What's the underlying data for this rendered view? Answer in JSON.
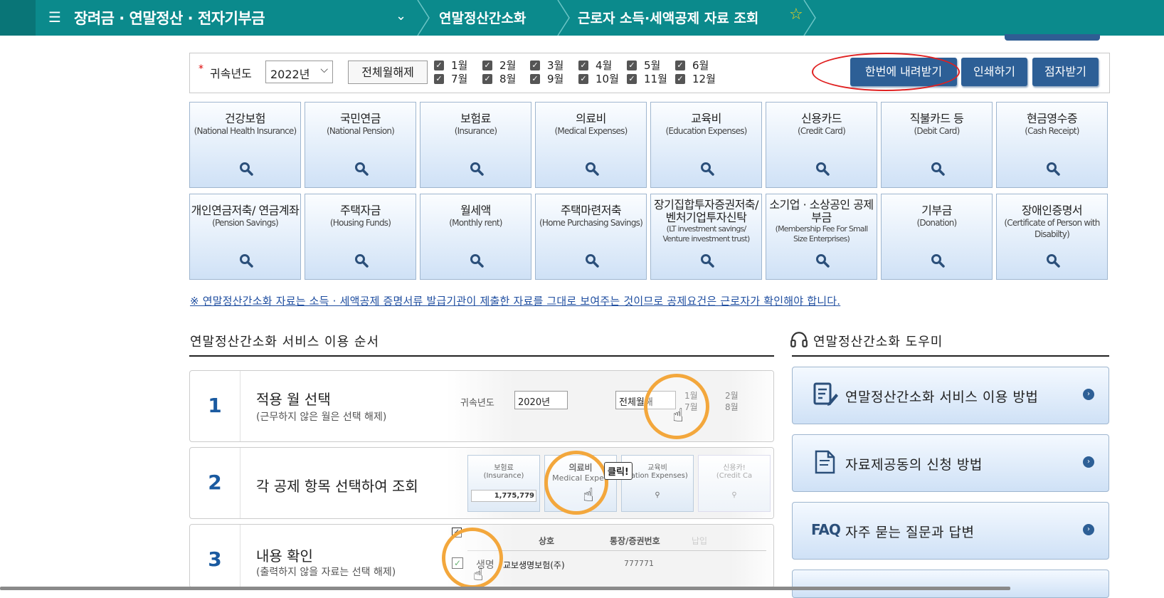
{
  "header": {
    "menu_icon": "hamburger-icon",
    "title": "장려금 · 연말정산 · 전자기부금",
    "crumb1": "연말정산간소화",
    "crumb2": "근로자 소득·세액공제 자료 조회",
    "star_icon": "star-icon",
    "bar_color": "#0b8a8c"
  },
  "filter": {
    "required_mark": "*",
    "year_label": "귀속년도",
    "year_value": "2022년",
    "deselect_all": "전체월해제",
    "months": [
      "1월",
      "2월",
      "3월",
      "4월",
      "5월",
      "6월",
      "7월",
      "8월",
      "9월",
      "10월",
      "11월",
      "12월"
    ],
    "download_all": "한번에 내려받기",
    "print": "인쇄하기",
    "braille": "점자받기"
  },
  "categories": [
    {
      "ko": "건강보험",
      "en": "(National Health Insurance)"
    },
    {
      "ko": "국민연금",
      "en": "(National Pension)"
    },
    {
      "ko": "보험료",
      "en": "(Insurance)"
    },
    {
      "ko": "의료비",
      "en": "(Medical Expenses)"
    },
    {
      "ko": "교육비",
      "en": "(Education Expenses)"
    },
    {
      "ko": "신용카드",
      "en": "(Credit Card)"
    },
    {
      "ko": "직불카드 등",
      "en": "(Debit Card)"
    },
    {
      "ko": "현금영수증",
      "en": "(Cash Receipt)"
    },
    {
      "ko": "개인연금저축/ 연금계좌",
      "en": "(Pension Savings)"
    },
    {
      "ko": "주택자금",
      "en": "(Housing Funds)"
    },
    {
      "ko": "월세액",
      "en": "(Monthly rent)"
    },
    {
      "ko": "주택마련저축",
      "en": "(Home Purchasing Savings)"
    },
    {
      "ko": "장기집합투자증권저축/ 벤처기업투자신탁",
      "en": "(LT investment savings/ Venture investment trust)"
    },
    {
      "ko": "소기업 · 소상공인 공제부금",
      "en": "(Membership Fee For Small Size Enterprises)"
    },
    {
      "ko": "기부금",
      "en": "(Donation)"
    },
    {
      "ko": "장애인증명서",
      "en": "(Certificate of Person with Disabilty)"
    }
  ],
  "notice": "※ 연말정산간소화 자료는 소득 · 세액공제 증명서류 발급기관이 제출한 자료를 그대로 보여주는 것이므로 공제요건은 근로자가 확인해야 합니다.",
  "steps_section": {
    "title": "연말정산간소화 서비스 이용 순서",
    "steps": [
      {
        "num": "1",
        "title": "적용 월 선택",
        "sub": "(근무하지 않은 월은 선택 해제)"
      },
      {
        "num": "2",
        "title": "각 공제 항목 선택하여 조회",
        "sub": ""
      },
      {
        "num": "3",
        "title": "내용 확인",
        "sub": "(출력하지 않을 자료는 선택 해제)"
      }
    ],
    "illu1": {
      "year_label": "귀속년도",
      "year": "2020년",
      "btn": "전체월해",
      "m1": "1월",
      "m7": "7월",
      "m2": "2월",
      "m8": "8월"
    },
    "illu2": {
      "c1": "보험료",
      "c1en": "(Insurance)",
      "c1val": "1,775,779",
      "c2": "의료비",
      "c2en": "Medical Expen",
      "click": "클릭!",
      "c3": "교육비",
      "c3en": "cation Expenses)",
      "c4": "신용카!",
      "c4en": "(Credit Ca"
    },
    "illu3": {
      "h1": "상호",
      "h2": "통장/증권번호",
      "h3": "납입",
      "r1a": "생명",
      "r1b": "교보생명보험(주)",
      "r1c": "777771"
    }
  },
  "help_section": {
    "title": "연말정산간소화 도우미",
    "icon": "headset-icon",
    "items": [
      {
        "label": "연말정산간소화 서비스 이용 방법",
        "icon": "document-pen-icon"
      },
      {
        "label": "자료제공동의 신청 방법",
        "icon": "document-icon"
      },
      {
        "label": "자주 묻는 질문과 답변",
        "icon": "faq-icon",
        "prefix": "FAQ"
      }
    ]
  }
}
